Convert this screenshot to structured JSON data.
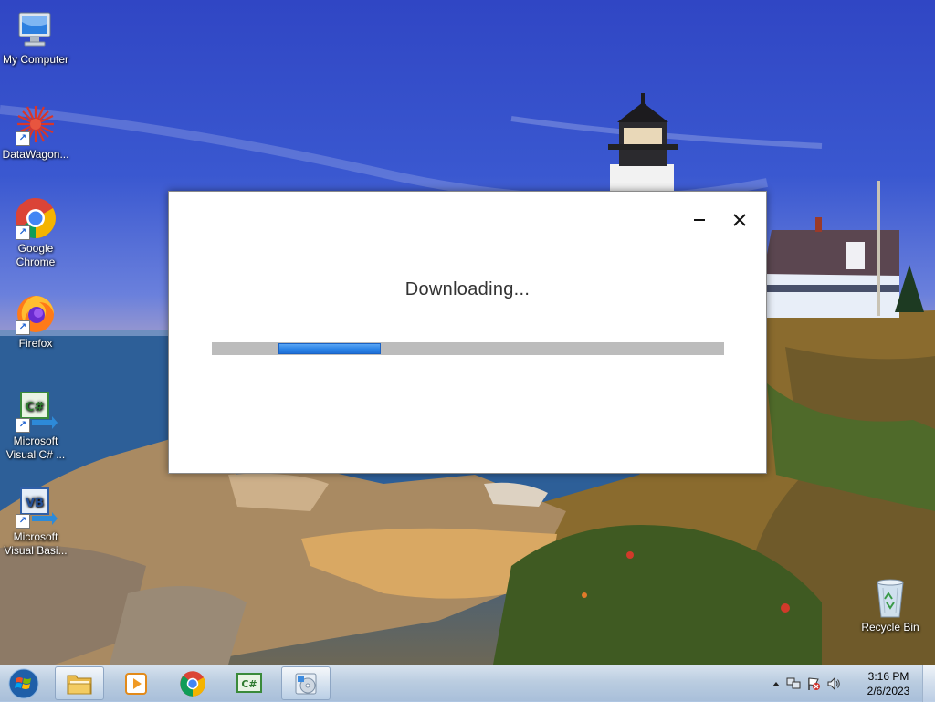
{
  "desktop": {
    "icons": [
      {
        "label": "My Computer",
        "icon": "computer-icon"
      },
      {
        "label": "DataWagon...",
        "icon": "datawagon-icon"
      },
      {
        "label": "Google Chrome",
        "icon": "chrome-icon"
      },
      {
        "label": "Firefox",
        "icon": "firefox-icon"
      },
      {
        "label": "Microsoft Visual C# ...",
        "icon": "visual-csharp-icon"
      },
      {
        "label": "Microsoft Visual Basi...",
        "icon": "visual-basic-icon"
      },
      {
        "label": "Recycle Bin",
        "icon": "recycle-bin-icon"
      }
    ]
  },
  "dialog": {
    "title": "Downloading...",
    "progress": {
      "start_fraction": 0.13,
      "width_fraction": 0.2
    },
    "minimize_glyph": "–",
    "close_glyph": "✕"
  },
  "taskbar": {
    "pinned": [
      {
        "name": "windows-explorer",
        "icon": "folder-icon"
      },
      {
        "name": "media-player",
        "icon": "media-player-icon"
      },
      {
        "name": "google-chrome",
        "icon": "chrome-icon"
      },
      {
        "name": "visual-csharp",
        "icon": "visual-csharp-icon"
      },
      {
        "name": "installer",
        "icon": "installer-icon"
      }
    ],
    "clock": {
      "time": "3:16 PM",
      "date": "2/6/2023"
    }
  },
  "colors": {
    "progress_fill": "#2c83e6",
    "progress_track": "#bcbcbc"
  }
}
